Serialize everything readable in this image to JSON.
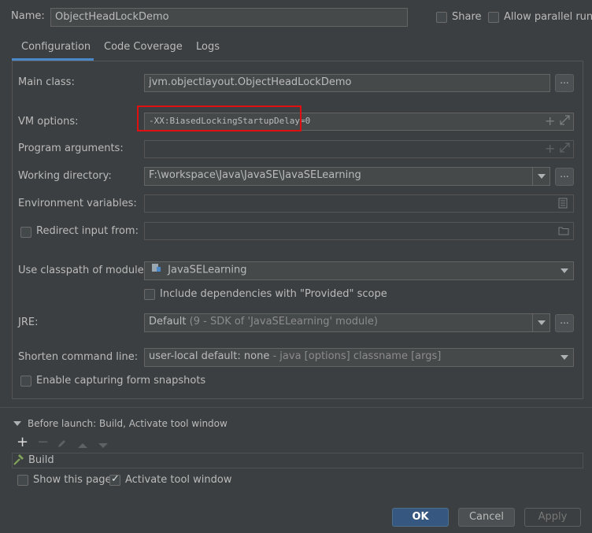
{
  "header": {
    "name_label": "Name:",
    "name_value": "ObjectHeadLockDemo",
    "share_label": "Share",
    "parallel_label": "Allow parallel run"
  },
  "tabs": [
    {
      "label": "Configuration",
      "active": true
    },
    {
      "label": "Code Coverage",
      "active": false
    },
    {
      "label": "Logs",
      "active": false
    }
  ],
  "form": {
    "main_class_label": "Main class:",
    "main_class_value": "jvm.objectlayout.ObjectHeadLockDemo",
    "vm_options_label": "VM options:",
    "vm_options_value": "-XX:BiasedLockingStartupDelay=0",
    "program_args_label": "Program arguments:",
    "program_args_value": "",
    "working_dir_label": "Working directory:",
    "working_dir_value": "F:\\workspace\\Java\\JavaSE\\JavaSELearning",
    "env_vars_label": "Environment variables:",
    "env_vars_value": "",
    "redirect_label": "Redirect input from:",
    "redirect_value": "",
    "classpath_label": "Use classpath of module:",
    "classpath_value": "JavaSELearning",
    "include_deps_label": "Include dependencies with \"Provided\" scope",
    "jre_label": "JRE:",
    "jre_value_bold": "Default",
    "jre_value_rest": "(9 - SDK of 'JavaSELearning' module)",
    "shorten_label": "Shorten command line:",
    "shorten_value_bold": "user-local default: none",
    "shorten_value_rest": "- java [options] classname [args]",
    "snapshots_label": "Enable capturing form snapshots",
    "dots": "..."
  },
  "before_launch": {
    "title": "Before launch: Build, Activate tool window",
    "items": [
      "Build"
    ],
    "show_page_label": "Show this page",
    "activate_label": "Activate tool window",
    "activate_checked": true
  },
  "footer": {
    "ok_label": "OK",
    "cancel_label": "Cancel",
    "apply_label": "Apply"
  },
  "colors": {
    "background": "#3c3f41",
    "field": "#45494a",
    "ok_button": "#365880",
    "highlight_box": "#e01010",
    "build_icon": "#7fa35a"
  }
}
